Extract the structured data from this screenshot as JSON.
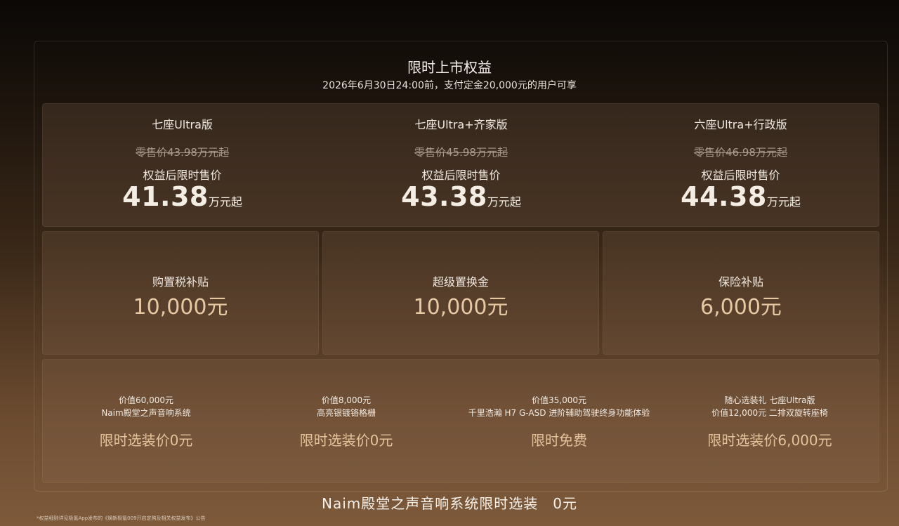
{
  "header": {
    "title": "限时上市权益",
    "subtitle": "2026年6月30日24:00前，支付定金20,000元的用户可享"
  },
  "models": [
    {
      "name": "七座Ultra版",
      "retail": "零售价43.98万元起",
      "label": "权益后限时售价",
      "price": "41.38",
      "unit": "万元起"
    },
    {
      "name": "七座Ultra+齐家版",
      "retail": "零售价45.98万元起",
      "label": "权益后限时售价",
      "price": "43.38",
      "unit": "万元起"
    },
    {
      "name": "六座Ultra+行政版",
      "retail": "零售价46.98万元起",
      "label": "权益后限时售价",
      "price": "44.38",
      "unit": "万元起"
    }
  ],
  "subsidies": [
    {
      "name": "购置税补贴",
      "amount": "10,000元"
    },
    {
      "name": "超级置换金",
      "amount": "10,000元"
    },
    {
      "name": "保险补贴",
      "amount": "6,000元"
    }
  ],
  "gifts": [
    {
      "line1": "价值60,000元",
      "line2": "Naim殿堂之声音响系统",
      "offer": "限时选装价0元"
    },
    {
      "line1": "价值8,000元",
      "line2": "高亮银镀铬格栅",
      "offer": "限时选装价0元"
    },
    {
      "line1": "价值35,000元",
      "line2": "千里浩瀚 H7 G-ASD 进阶辅助驾驶终身功能体验",
      "offer": "限时免费"
    },
    {
      "line1": "随心选装礼 七座Ultra版",
      "line2": "价值12,000元 二排双旋转座椅",
      "offer": "限时选装价6,000元"
    }
  ],
  "banner": "Naim殿堂之声音响系统限时选装　0元",
  "footnote": "*权益细则详见极氪App发布的《焕新极氪009开启定购及相关权益发布》公告",
  "colors": {
    "accent": "#e6c9a2",
    "text": "#f2ece4",
    "strike": "#a89a8c"
  }
}
